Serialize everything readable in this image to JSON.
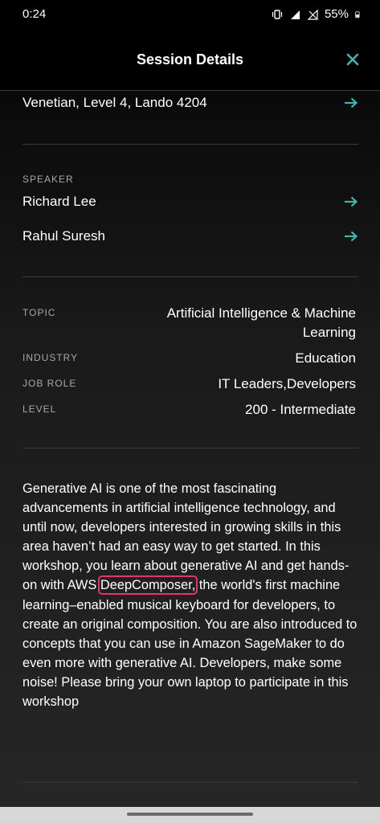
{
  "status_bar": {
    "time": "0:24",
    "battery": "55%"
  },
  "header": {
    "title": "Session Details"
  },
  "location": {
    "text": "Venetian, Level 4, Lando 4204"
  },
  "speakers": {
    "label": "SPEAKER",
    "items": [
      {
        "name": "Richard Lee"
      },
      {
        "name": "Rahul Suresh"
      }
    ]
  },
  "details": {
    "topic_label": "TOPIC",
    "topic_line1": "Artificial Intelligence & Machine",
    "topic_line2": "Learning",
    "industry_label": "INDUSTRY",
    "industry_value": "Education",
    "job_role_label": "JOB ROLE",
    "job_role_value": "IT Leaders,Developers",
    "level_label": "LEVEL",
    "level_value": "200 - Intermediate"
  },
  "description": {
    "before": "Generative AI is one of the most fascinating advancements in artificial intelligence technology, and until now, developers interested in growing skills in this area haven’t had an easy way to get started. In this workshop, you learn about generative AI and get hands-on with AWS ",
    "highlight": "DeepComposer,",
    "after": " the world's first machine learning–enabled musical keyboard for developers, to create an original composition. You are also introduced to concepts that you can use in Amazon SageMaker to do even more with generative AI. Developers, make some noise! Please bring your own laptop to participate in this workshop"
  },
  "colors": {
    "accent": "#3fb8af",
    "highlight_border": "#e0366b"
  },
  "icons": {
    "close": "close-icon",
    "arrow": "arrow-right-icon"
  }
}
